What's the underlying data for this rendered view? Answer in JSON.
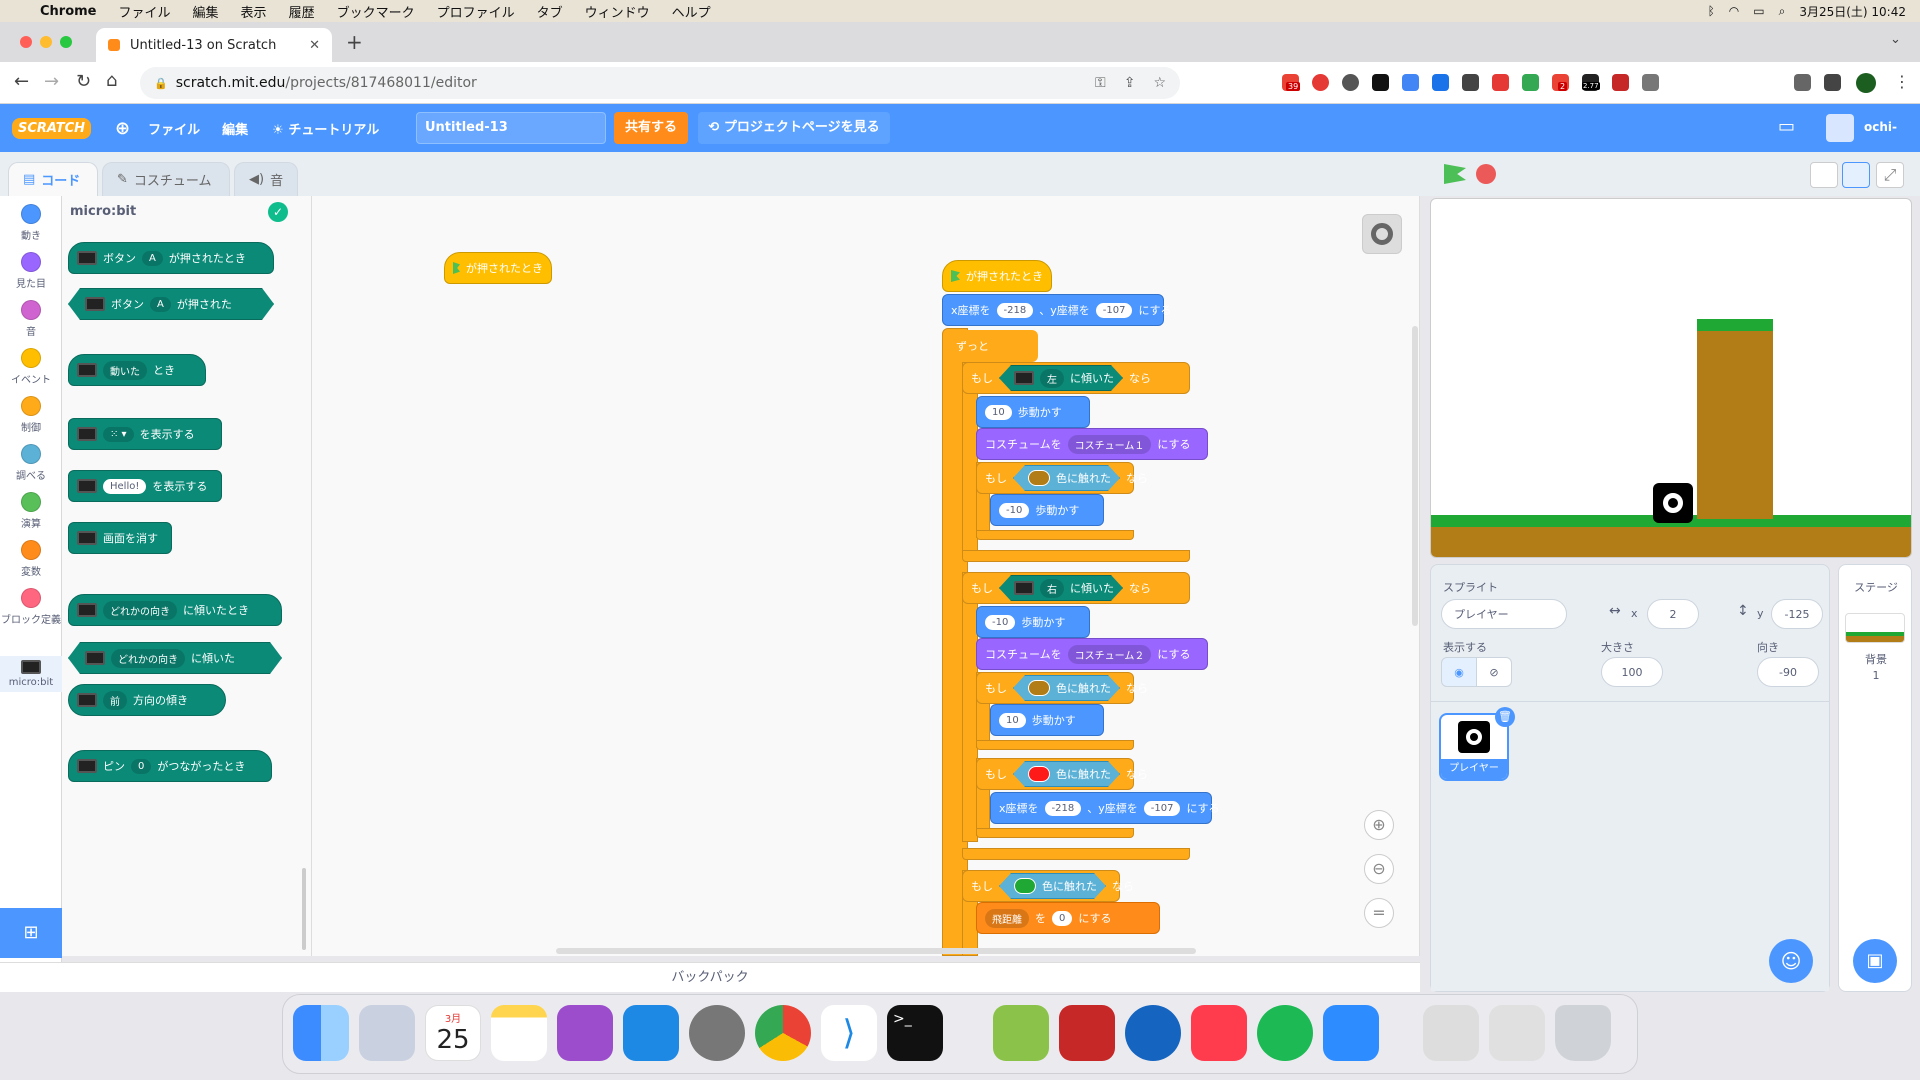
{
  "menubar": {
    "app": "Chrome",
    "items": [
      "ファイル",
      "編集",
      "表示",
      "履歴",
      "ブックマーク",
      "プロファイル",
      "タブ",
      "ウィンドウ",
      "ヘルプ"
    ],
    "datetime": "3月25日(土) 10:42"
  },
  "browser": {
    "tab_title": "Untitled-13 on Scratch",
    "url_host": "scratch.mit.edu",
    "url_path": "/projects/817468011/editor",
    "ext_badges": [
      "39",
      "2",
      "2.77"
    ]
  },
  "scratch_header": {
    "logo": "SCRATCH",
    "file": "ファイル",
    "edit": "編集",
    "tutorial": "チュートリアル",
    "project_title": "Untitled-13",
    "share": "共有する",
    "project_page": "プロジェクトページを見る",
    "user": "ochi-"
  },
  "editor_tabs": {
    "code": "コード",
    "costume": "コスチューム",
    "sound": "音"
  },
  "categories": [
    {
      "label": "動き",
      "color": "#4c97ff"
    },
    {
      "label": "見た目",
      "color": "#9966ff"
    },
    {
      "label": "音",
      "color": "#cf63cf"
    },
    {
      "label": "イベント",
      "color": "#ffbf00"
    },
    {
      "label": "制御",
      "color": "#ffab19"
    },
    {
      "label": "調べる",
      "color": "#5cb1d6"
    },
    {
      "label": "演算",
      "color": "#59c059"
    },
    {
      "label": "変数",
      "color": "#ff8c1a"
    },
    {
      "label": "ブロック定義",
      "color": "#ff6680"
    },
    {
      "label": "micro:bit",
      "color": "#0b8a78"
    }
  ],
  "palette": {
    "title": "micro:bit",
    "b1": {
      "pre": "ボタン",
      "drop": "A",
      "post": "が押されたとき"
    },
    "b2": {
      "pre": "ボタン",
      "drop": "A",
      "post": "が押された"
    },
    "b3": {
      "drop": "動いた",
      "post": "とき"
    },
    "b4": {
      "post": "を表示する"
    },
    "b5": {
      "pill": "Hello!",
      "post": "を表示する"
    },
    "b6": {
      "post": "画面を消す"
    },
    "b7": {
      "drop": "どれかの向き",
      "post": "に傾いたとき"
    },
    "b8": {
      "drop": "どれかの向き",
      "post": "に傾いた"
    },
    "b9": {
      "drop": "前",
      "post": "方向の傾き"
    },
    "b10": {
      "pre": "ピン",
      "drop": "0",
      "post": "がつながったとき"
    }
  },
  "script": {
    "loose_hat": "が押されたとき",
    "hat": "が押されたとき",
    "goto1": {
      "pre": "x座標を",
      "x": "-218",
      "mid": "、y座標を",
      "y": "-107",
      "post": "にする"
    },
    "forever": "ずっと",
    "if1": {
      "if": "もし",
      "drop": "左",
      "post": "に傾いた",
      "then": "なら"
    },
    "move1": {
      "val": "10",
      "post": "歩動かす"
    },
    "costume1": {
      "pre": "コスチュームを",
      "drop": "コスチューム１",
      "post": "にする"
    },
    "if2": {
      "if": "もし",
      "post": "色に触れた",
      "then": "なら"
    },
    "move2": {
      "val": "-10",
      "post": "歩動かす"
    },
    "if3": {
      "if": "もし",
      "drop": "右",
      "post": "に傾いた",
      "then": "なら"
    },
    "move3": {
      "val": "-10",
      "post": "歩動かす"
    },
    "costume2": {
      "pre": "コスチュームを",
      "drop": "コスチューム２",
      "post": "にする"
    },
    "if4": {
      "if": "もし",
      "post": "色に触れた",
      "then": "なら"
    },
    "move4": {
      "val": "10",
      "post": "歩動かす"
    },
    "if5": {
      "if": "もし",
      "post": "色に触れた",
      "then": "なら"
    },
    "goto2": {
      "pre": "x座標を",
      "x": "-218",
      "mid": "、y座標を",
      "y": "-107",
      "post": "にする"
    },
    "if6": {
      "if": "もし",
      "post": "色に触れた",
      "then": "なら"
    },
    "setvar": {
      "drop": "飛距離",
      "mid": "を",
      "val": "0",
      "post": "にする"
    }
  },
  "sprite_info": {
    "sprite_label": "スプライト",
    "sprite_name": "プレイヤー",
    "x_label": "x",
    "x": "2",
    "y_label": "y",
    "y": "-125",
    "show_label": "表示する",
    "size_label": "大きさ",
    "size": "100",
    "dir_label": "向き",
    "direction": "-90",
    "thumb_name": "プレイヤー"
  },
  "stage_pane": {
    "title": "ステージ",
    "bg_label": "背景",
    "bg_count": "1"
  },
  "backpack": "バックパック",
  "dock_date": {
    "month": "3月",
    "day": "25"
  },
  "colors": {
    "brown": "#b27c16",
    "red": "#ff1a1a",
    "green": "#1fa834"
  }
}
